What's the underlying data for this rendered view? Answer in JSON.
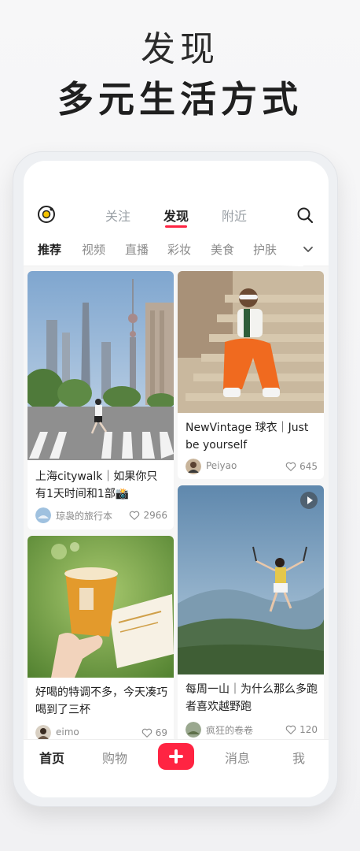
{
  "promo": {
    "subtitle": "发现",
    "title": "多元生活方式"
  },
  "topnav": {
    "tabs": [
      "关注",
      "发现",
      "附近"
    ],
    "active_tab": "发现"
  },
  "categories": {
    "items": [
      "推荐",
      "视频",
      "直播",
      "彩妆",
      "美食",
      "护肤"
    ],
    "active": "推荐"
  },
  "feed": {
    "cards": [
      {
        "title": "上海citywalk｜如果你只有1天时间和1部📸",
        "author": "琼袅的旅行本",
        "likes": "2966"
      },
      {
        "title": "NewVintage 球衣｜Just be yourself",
        "author": "Peiyao",
        "likes": "645"
      },
      {
        "title": "好喝的特调不多，今天凑巧喝到了三杯",
        "author": "eimo",
        "likes": "69"
      },
      {
        "title": "每周一山｜为什么那么多跑者喜欢越野跑",
        "author": "疯狂的卷卷",
        "likes": "120"
      }
    ]
  },
  "bottombar": {
    "home": "首页",
    "shop": "购物",
    "messages": "消息",
    "me": "我"
  },
  "colors": {
    "accent": "#ff2442",
    "text_primary": "#222222",
    "text_secondary": "#8a8a8a"
  }
}
